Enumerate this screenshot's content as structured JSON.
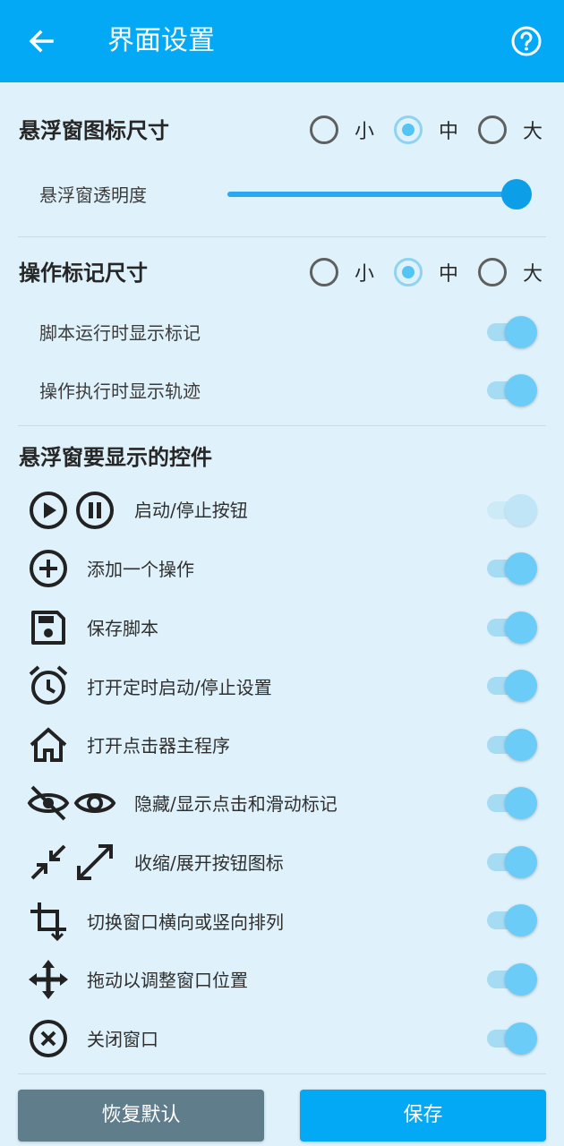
{
  "appbar": {
    "title": "界面设置"
  },
  "float_icon_size": {
    "title": "悬浮窗图标尺寸",
    "options": [
      "小",
      "中",
      "大"
    ],
    "selected": "中",
    "opacity_label": "悬浮窗透明度",
    "opacity_value": 1.0
  },
  "mark_size": {
    "title": "操作标记尺寸",
    "options": [
      "小",
      "中",
      "大"
    ],
    "selected": "中",
    "toggles": [
      {
        "label": "脚本运行时显示标记",
        "on": true
      },
      {
        "label": "操作执行时显示轨迹",
        "on": true
      }
    ]
  },
  "controls": {
    "title": "悬浮窗要显示的控件",
    "items": [
      {
        "label": "启动/停止按钮",
        "icons": [
          "play-circle-icon",
          "pause-circle-icon"
        ],
        "on": true,
        "enabled": false
      },
      {
        "label": "添加一个操作",
        "icons": [
          "add-circle-icon"
        ],
        "on": true,
        "enabled": true
      },
      {
        "label": "保存脚本",
        "icons": [
          "save-icon"
        ],
        "on": true,
        "enabled": true
      },
      {
        "label": "打开定时启动/停止设置",
        "icons": [
          "alarm-clock-icon"
        ],
        "on": true,
        "enabled": true
      },
      {
        "label": "打开点击器主程序",
        "icons": [
          "home-icon"
        ],
        "on": true,
        "enabled": true
      },
      {
        "label": "隐藏/显示点击和滑动标记",
        "icons": [
          "eye-off-icon",
          "eye-icon"
        ],
        "on": true,
        "enabled": true
      },
      {
        "label": "收缩/展开按钮图标",
        "icons": [
          "collapse-icon",
          "expand-icon"
        ],
        "on": true,
        "enabled": true
      },
      {
        "label": "切换窗口横向或竖向排列",
        "icons": [
          "crop-rotate-icon"
        ],
        "on": true,
        "enabled": true
      },
      {
        "label": "拖动以调整窗口位置",
        "icons": [
          "move-icon"
        ],
        "on": true,
        "enabled": true
      },
      {
        "label": "关闭窗口",
        "icons": [
          "close-circle-icon"
        ],
        "on": true,
        "enabled": true
      }
    ]
  },
  "footer": {
    "restore_label": "恢复默认",
    "save_label": "保存"
  },
  "colors": {
    "primary": "#03a9f4",
    "background": "#dff2fb",
    "restore_button": "#607d8b"
  }
}
